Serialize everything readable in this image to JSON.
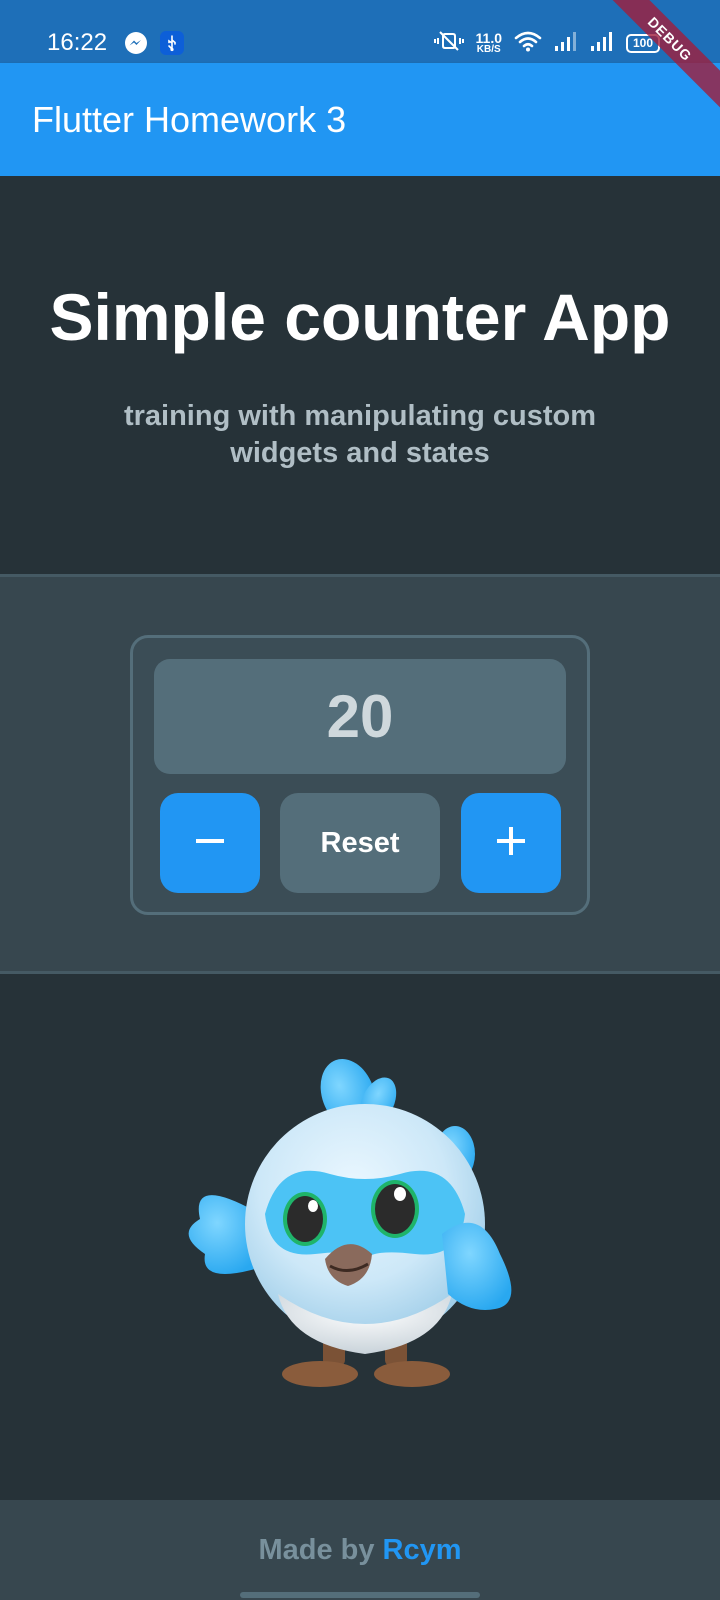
{
  "status_bar": {
    "time": "16:22",
    "left_icons": [
      "messenger-icon",
      "usb-icon"
    ],
    "net_speed_value": "11.0",
    "net_speed_unit": "KB/S",
    "battery": "100",
    "right_icons": [
      "vibrate-off-icon",
      "wifi-icon",
      "signal-icon",
      "signal-icon",
      "battery-icon"
    ],
    "debug_banner": "DEBUG"
  },
  "app_bar": {
    "title": "Flutter Homework 3"
  },
  "header": {
    "title": "Simple counter App",
    "subtitle": "training with manipulating custom widgets and states"
  },
  "counter": {
    "value": "20",
    "decrement_icon": "minus-icon",
    "reset_label": "Reset",
    "increment_icon": "plus-icon"
  },
  "mascot": {
    "icon": "dash-bird-mascot"
  },
  "footer": {
    "prefix": "Made by",
    "author": "Rcym"
  },
  "colors": {
    "primary": "#2196f3",
    "status_bar": "#1e6fb8",
    "background": "#263238",
    "panel": "#37474f",
    "display": "#546e7a",
    "subtitle": "#b0bec5"
  }
}
